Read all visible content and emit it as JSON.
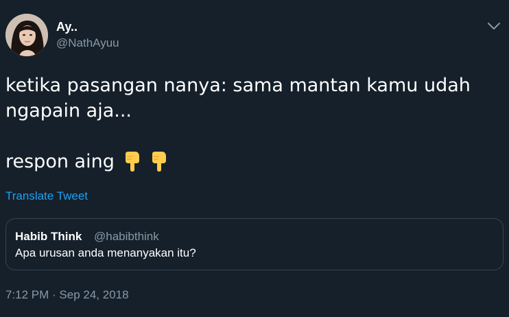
{
  "author": {
    "name": "Ay..",
    "handle": "@NathAyuu"
  },
  "menu": {
    "icon": "chevron-down-icon"
  },
  "tweet": {
    "lines": [
      "ketika pasangan nanya: sama mantan kamu udah",
      "ngapain aja...",
      "respon aing"
    ],
    "emoji": [
      "backhand-index-pointing-down",
      "backhand-index-pointing-down"
    ]
  },
  "translate_label": "Translate Tweet",
  "quoted_tweet": {
    "name": "Habib Think",
    "handle": "@habibthink",
    "text": "Apa urusan anda menanyakan itu?"
  },
  "timestamp": "7:12 PM · Sep 24, 2018",
  "colors": {
    "background": "#15202b",
    "secondary_text": "#8899a6",
    "link": "#1da1f2",
    "border": "#38444d",
    "emoji": "#ffcc4d"
  }
}
